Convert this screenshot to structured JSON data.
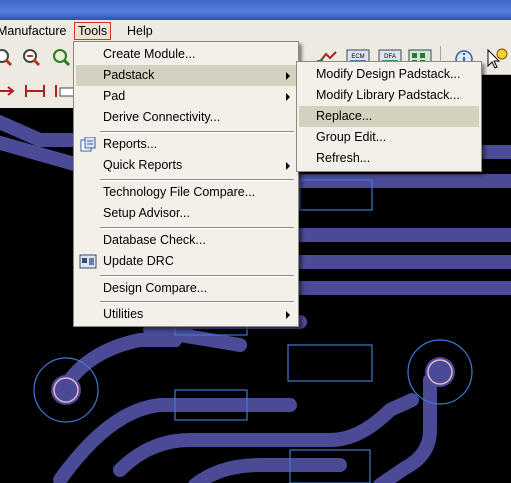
{
  "menubar": {
    "manufacture": "Manufacture",
    "tools": "Tools",
    "help": "Help"
  },
  "toolbar_icons": [
    "zoom-in-icon",
    "zoom-out-icon",
    "zoom-fit-icon",
    "ecm-icon",
    "dfa-icon",
    "grid-icon",
    "info-icon"
  ],
  "toolbar_badges": {
    "ecm": "ECM",
    "dfa": "DFA"
  },
  "tools_menu": {
    "create_module": "Create Module...",
    "padstack": "Padstack",
    "pad": "Pad",
    "derive_connectivity": "Derive Connectivity...",
    "reports": "Reports...",
    "quick_reports": "Quick Reports",
    "technology_file_compare": "Technology File Compare...",
    "setup_advisor": "Setup Advisor...",
    "database_check": "Database Check...",
    "update_drc": "Update DRC",
    "design_compare": "Design Compare...",
    "utilities": "Utilities"
  },
  "padstack_submenu": {
    "modify_design_padstack": "Modify Design Padstack...",
    "modify_library_padstack": "Modify Library Padstack...",
    "replace": "Replace...",
    "group_edit": "Group Edit...",
    "refresh": "Refresh..."
  },
  "colors": {
    "trace": "#4a4a96",
    "pad_outline": "#3a7bd5",
    "drill_ring": "#e8b4c8",
    "canvas_bg": "#000000",
    "menu_bg": "#f2f0e8",
    "menu_highlight": "#d4d2bf"
  }
}
